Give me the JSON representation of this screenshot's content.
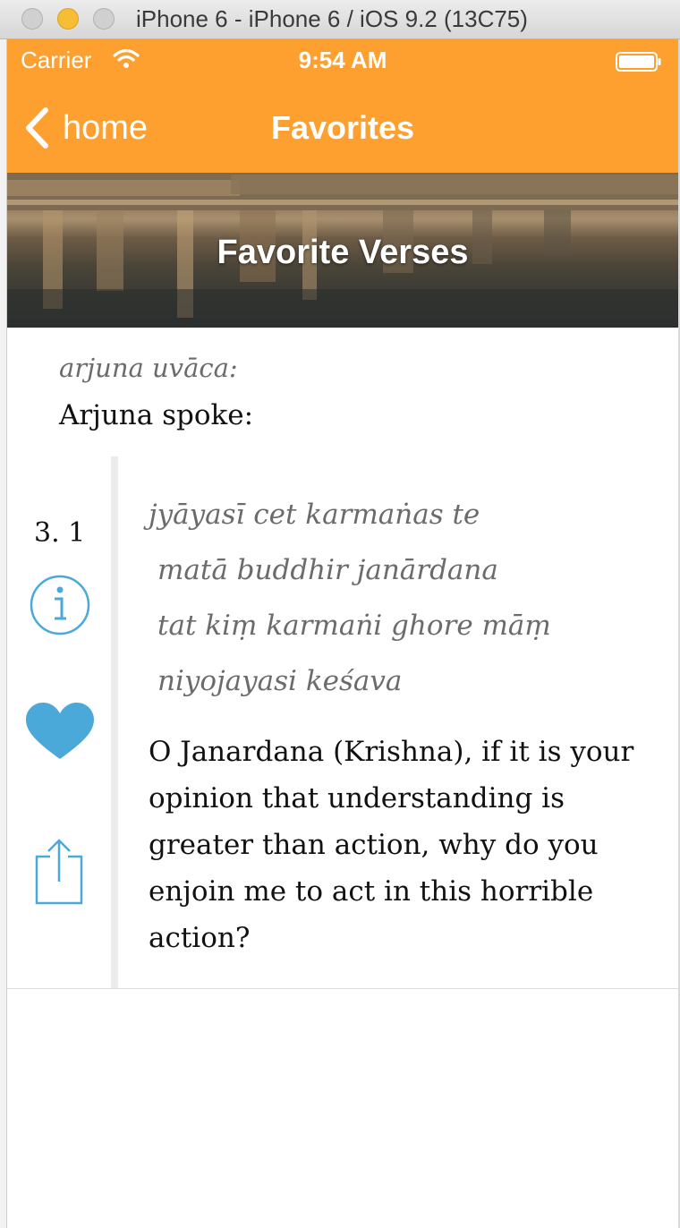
{
  "window": {
    "title": "iPhone 6 - iPhone 6 / iOS 9.2 (13C75)"
  },
  "status_bar": {
    "carrier": "Carrier",
    "time": "9:54 AM"
  },
  "nav_bar": {
    "back_label": "home",
    "title": "Favorites",
    "background_color": "#fda02f"
  },
  "hero": {
    "title": "Favorite Verses"
  },
  "verse": {
    "speaker_sanskrit": "arjuna uvāca:",
    "speaker_english": "Arjuna spoke:",
    "number": "3. 1",
    "sanskrit_lines": [
      "jyāyasī cet karmaṅas te",
      "matā buddhir janārdana",
      "tat kiṃ karmaṅi ghore māṃ",
      "niyojayasi keśava"
    ],
    "translation": "O Janardana (Krishna), if it is your opinion that understanding is greater than action, why do you enjoin me to act in this horrible action?",
    "icons": [
      "info-icon",
      "heart-icon",
      "share-icon"
    ],
    "accent_color": "#4aa9d8"
  }
}
